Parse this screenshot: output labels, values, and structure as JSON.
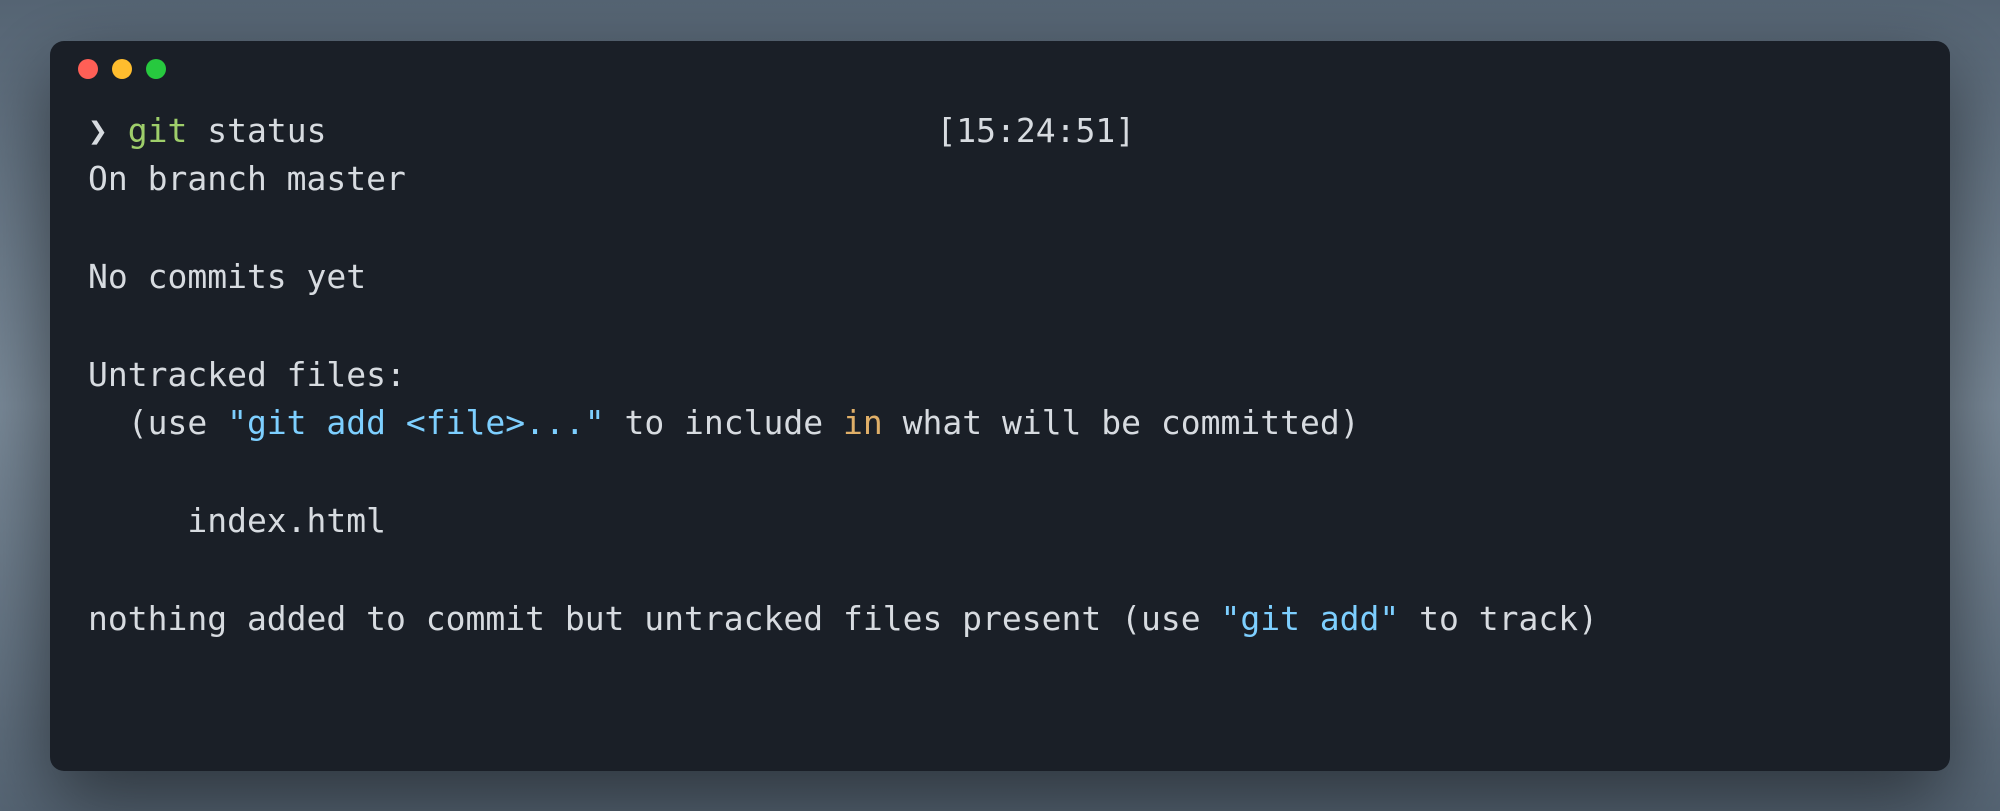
{
  "prompt": {
    "symbol": "❯",
    "cmd_git": "git",
    "cmd_args": " status",
    "timestamp": "[15:24:51]"
  },
  "output": {
    "branch_line": "On branch master",
    "blank": "",
    "no_commits": "No commits yet",
    "untracked_header": "Untracked files:",
    "hint_prefix": "  (use ",
    "hint_cmd_quoted": "\"git add <file>...\"",
    "hint_mid1": " to include ",
    "hint_in": "in",
    "hint_mid2": " what will be committed)",
    "file_line": "     index.html",
    "summary_prefix": "nothing added to commit but untracked files present (use ",
    "summary_cmd_quoted": "\"git add\"",
    "summary_suffix": " to track)"
  }
}
